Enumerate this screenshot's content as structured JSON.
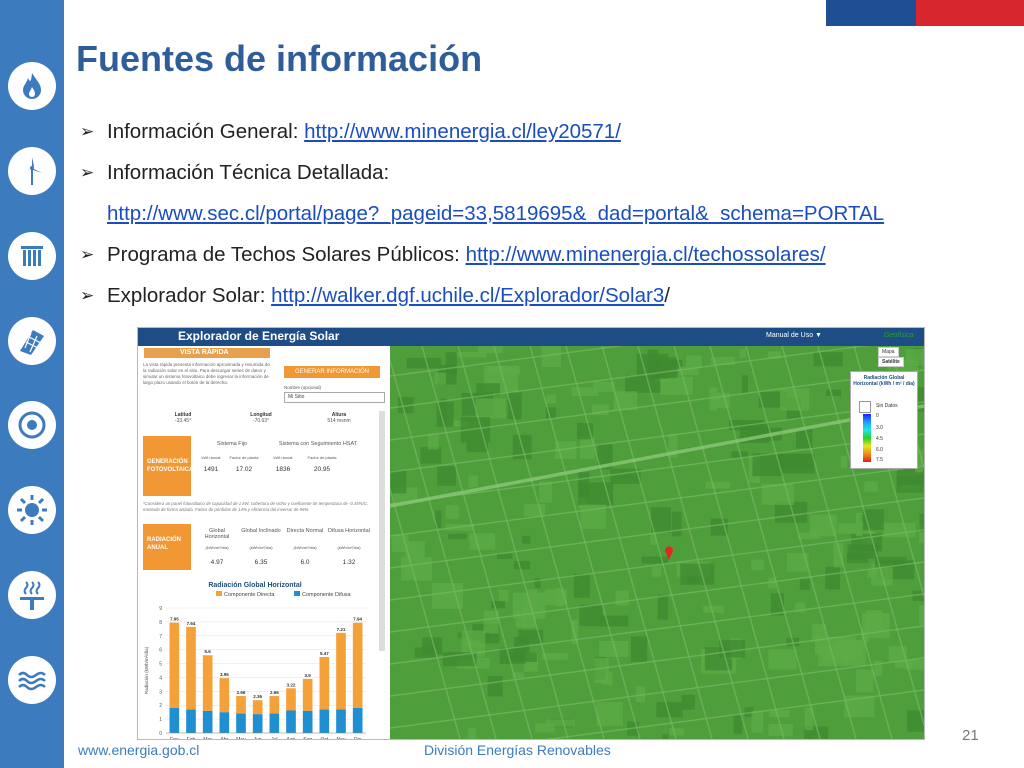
{
  "slide": {
    "title": "Fuentes de información",
    "page_number": "21",
    "footer_left": "www.energia.gob.cl",
    "footer_right": "División Energías Renovables"
  },
  "bullets": [
    {
      "label": "Información General: ",
      "link": "http://www.minenergia.cl/ley20571/",
      "after": ""
    },
    {
      "label": "Información Técnica Detallada:",
      "link": "",
      "after": ""
    },
    {
      "label": "",
      "link": "http://www.sec.cl/portal/page?_pageid=33,5819695&_dad=portal&_schema=PORTAL",
      "after": ""
    },
    {
      "label": "Programa de Techos Solares Públicos: ",
      "link": "http://www.minenergia.cl/techossolares/",
      "after": ""
    },
    {
      "label": "Explorador Solar: ",
      "link": "http://walker.dgf.uchile.cl/Explorador/Solar3",
      "after": "/"
    }
  ],
  "colors": {
    "sidebar": "#3d7bbf",
    "title": "#2e5d99",
    "link": "#1a4dbf",
    "flag_blue": "#1f4e94",
    "flag_red": "#d8262e",
    "orange": "#f19834",
    "blue_bar": "#1f8fd1",
    "map_green": "#4e9e3c"
  },
  "sidebar_icons": [
    "flame-icon",
    "wind-turbine-icon",
    "column-icon",
    "solar-panel-icon",
    "sun-gear-icon",
    "sun-icon",
    "geothermal-icon",
    "water-icon"
  ],
  "explorer": {
    "app_title": "Explorador de Energía Solar",
    "manual_label": "Manual de Uso ▼",
    "tab_label": "VISTA RÁPIDA",
    "intro_text": "La vista rápida presenta información aproximada y resumida de la radiación solar en el sitio. Para descargar series de datos y simular un sistema fotovoltaico debe ingresar la información de largo plazo usando el botón de la derecha.",
    "generate_button": "GENERAR INFORMACIÓN",
    "name_label": "Nombre (opcional)",
    "name_value": "Mi Sitio",
    "coords": [
      {
        "label": "Latitud",
        "value": "-33.45°"
      },
      {
        "label": "Longitud",
        "value": "-70.63°"
      },
      {
        "label": "Altura",
        "value": "514 msnm"
      }
    ],
    "pv": {
      "label": "GENERACIÓN FOTOVOLTAICA*",
      "fixed_header": "Sistema Fijo",
      "tracking_header": "Sistema con Seguimiento HSAT",
      "sub_headers": [
        "kWh anual",
        "Factor de planta",
        "kWh anual",
        "Factor de planta"
      ],
      "values": [
        "1491",
        "17.02",
        "1836",
        "20.95"
      ]
    },
    "note": "*Considera un panel fotovoltaico de capacidad de 1 kW, cobertura de vidrio y coeficiente de temperatura de -0.45%/C, montado de forma aislada. Factor de pérdidas de 14% y eficiencia del inversor de 96%.",
    "radiation": {
      "label": "RADIACIÓN ANUAL",
      "headers": [
        "Global Horizontal",
        "Global Inclinado",
        "Directa Normal",
        "Difusa Horizontal"
      ],
      "units": [
        "(kWh/m²/día)",
        "(kWh/m²/día)",
        "(kWh/m²/día)",
        "(kWh/m²/día)"
      ],
      "values": [
        "4.97",
        "6.35",
        "6.0",
        "1.32"
      ]
    },
    "map_type": [
      "Mapa",
      "Satélite"
    ],
    "map_brand": "Geofísica",
    "legend": {
      "title": "Radiación Global Horizontal (kWh / m² / día)",
      "no_data": "Sin Datos",
      "ticks": [
        "0",
        "3.0",
        "4.5",
        "6.0",
        "7.5"
      ]
    }
  },
  "chart_data": {
    "type": "bar",
    "title": "Radiación Global Horizontal",
    "categories": [
      "Ene",
      "Feb",
      "Mar",
      "Abr",
      "May",
      "Jun",
      "Jul",
      "Ago",
      "Sep",
      "Oct",
      "Nov",
      "Dic"
    ],
    "series": [
      {
        "name": "Componente Directa",
        "color": "#f4a13a",
        "values": [
          6.15,
          5.94,
          4.0,
          2.45,
          1.26,
          1.0,
          1.26,
          1.6,
          2.3,
          3.77,
          5.51,
          6.14
        ]
      },
      {
        "name": "Componente Difusa",
        "color": "#1f8fd1",
        "values": [
          1.8,
          1.7,
          1.6,
          1.5,
          1.4,
          1.36,
          1.4,
          1.62,
          1.6,
          1.7,
          1.7,
          1.8
        ]
      }
    ],
    "totals": [
      "7.95",
      "7.64",
      "5.6",
      "3.95",
      "2.66",
      "2.36",
      "2.66",
      "3.22",
      "3.9",
      "5.47",
      "7.21",
      "7.94"
    ],
    "ylim": [
      0,
      9
    ],
    "yticks": [
      0,
      1,
      2,
      3,
      4,
      5,
      6,
      7,
      8,
      9
    ],
    "ylabel": "Radiación (kWh/m²/día)",
    "stacked": true
  }
}
